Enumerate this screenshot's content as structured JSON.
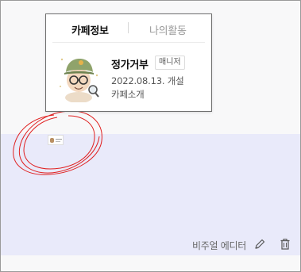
{
  "popover": {
    "tabs": [
      {
        "label": "카페정보",
        "active": true
      },
      {
        "label": "나의활동",
        "active": false
      }
    ],
    "nickname": "정가거부",
    "role": "매니저",
    "opened": "2022.08.13. 개설",
    "intro_link": "카페소개"
  },
  "toolbar": {
    "visual_editor_label": "비주얼 에디터",
    "edit_icon": "pencil-icon",
    "delete_icon": "trash-icon"
  },
  "colors": {
    "editor_bg": "#e9eafa",
    "scribble": "#e02020"
  }
}
